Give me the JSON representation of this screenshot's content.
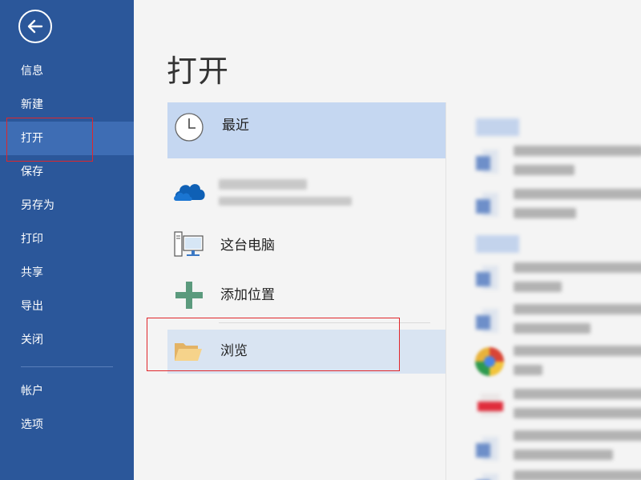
{
  "window": {
    "title": "打开"
  },
  "sidebar": {
    "back_icon": "back-arrow-icon",
    "items": [
      {
        "label": "信息"
      },
      {
        "label": "新建"
      },
      {
        "label": "打开",
        "active": true
      },
      {
        "label": "保存"
      },
      {
        "label": "另存为"
      },
      {
        "label": "打印"
      },
      {
        "label": "共享"
      },
      {
        "label": "导出"
      },
      {
        "label": "关闭"
      },
      {
        "label": "帐户"
      },
      {
        "label": "选项"
      }
    ],
    "bg_color": "#2b579a",
    "active_color": "#3e6db4"
  },
  "main": {
    "title": "打开",
    "locations": [
      {
        "label": "最近",
        "icon": "clock-icon",
        "selected": true
      },
      {
        "label": "",
        "icon": "onedrive-cloud-icon"
      },
      {
        "label": "这台电脑",
        "icon": "computer-icon"
      },
      {
        "label": "添加位置",
        "icon": "plus-icon"
      },
      {
        "label": "浏览",
        "icon": "folder-icon",
        "highlighted": true
      }
    ]
  },
  "colors": {
    "selected_bg": "#c5d7f1",
    "highlight_border": "#e0262b"
  }
}
